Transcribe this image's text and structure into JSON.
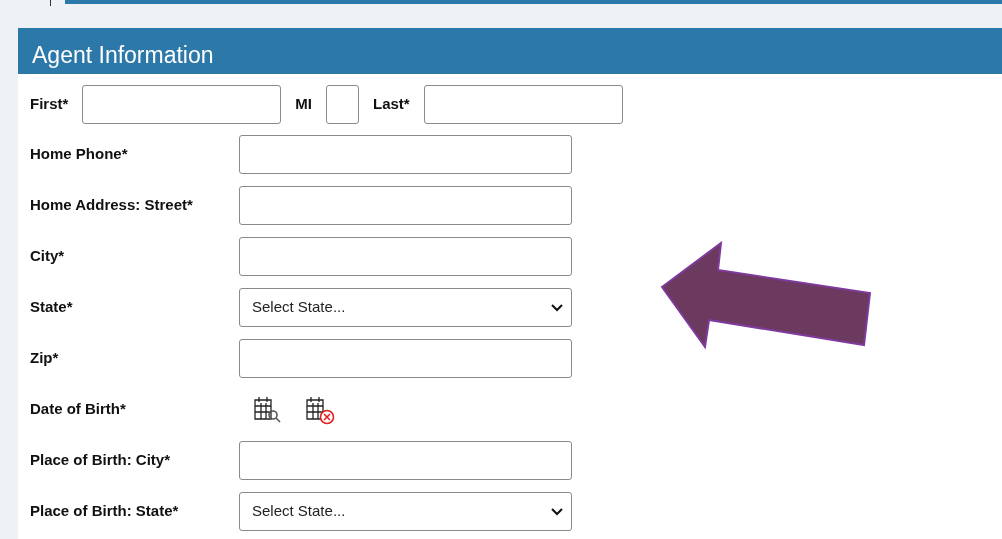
{
  "panel": {
    "title": "Agent Information"
  },
  "name_row": [
    {
      "label": "First*",
      "kind": "name"
    },
    {
      "label": "MI",
      "kind": "initial"
    },
    {
      "label": "Last*",
      "kind": "name"
    }
  ],
  "fields": [
    {
      "label": "Home Phone*",
      "kind": "text"
    },
    {
      "label": "Home Address: Street*",
      "kind": "text"
    },
    {
      "label": "City*",
      "kind": "text"
    },
    {
      "label": "State*",
      "kind": "select",
      "value": "Select State..."
    },
    {
      "label": "Zip*",
      "kind": "text"
    },
    {
      "label": "Date of Birth*",
      "kind": "date"
    },
    {
      "label": "Place of Birth: City*",
      "kind": "text"
    },
    {
      "label": "Place of Birth: State*",
      "kind": "select",
      "value": "Select State..."
    }
  ]
}
